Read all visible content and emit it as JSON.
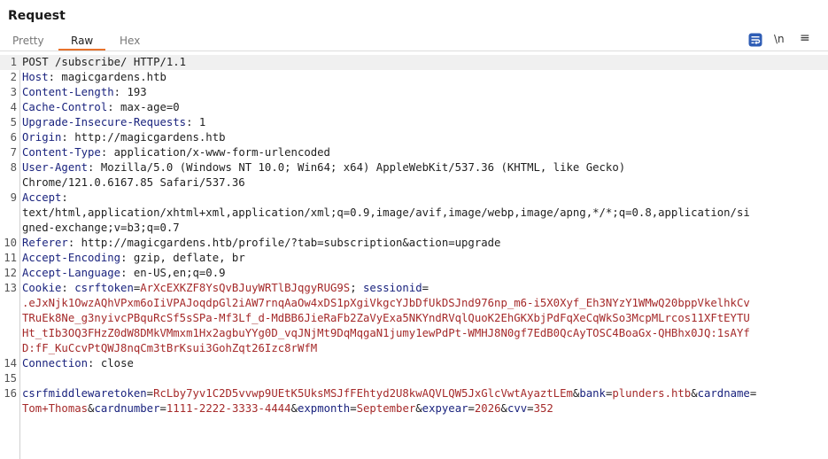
{
  "panel": {
    "title": "Request"
  },
  "tabs": [
    {
      "label": "Pretty"
    },
    {
      "label": "Raw"
    },
    {
      "label": "Hex"
    }
  ],
  "toolbar": {
    "newline_label": "\\n",
    "menu_label": "≡",
    "wrap_icon": "wrap-lines-icon"
  },
  "colors": {
    "accent": "#e8722c",
    "header_name": "#1a237e",
    "param_value": "#a52a2a",
    "highlight_btn": "#2f5db5"
  },
  "request": {
    "lines": [
      {
        "n": "1",
        "text": "POST /subscribe/ HTTP/1.1"
      },
      {
        "n": "2",
        "name": "Host",
        "value": ": magicgardens.htb"
      },
      {
        "n": "3",
        "name": "Content-Length",
        "value": ": 193"
      },
      {
        "n": "4",
        "name": "Cache-Control",
        "value": ": max-age=0"
      },
      {
        "n": "5",
        "name": "Upgrade-Insecure-Requests",
        "value": ": 1"
      },
      {
        "n": "6",
        "name": "Origin",
        "value": ": http://magicgardens.htb"
      },
      {
        "n": "7",
        "name": "Content-Type",
        "value": ": application/x-www-form-urlencoded"
      },
      {
        "n": "8",
        "name": "User-Agent",
        "value": ": Mozilla/5.0 (Windows NT 10.0; Win64; x64) AppleWebKit/537.36 (KHTML, like Gecko)"
      },
      {
        "n": "",
        "text": "Chrome/121.0.6167.85 Safari/537.36"
      },
      {
        "n": "9",
        "name": "Accept",
        "value": ":"
      },
      {
        "n": "",
        "text": "text/html,application/xhtml+xml,application/xml;q=0.9,image/avif,image/webp,image/apng,*/*;q=0.8,application/si"
      },
      {
        "n": "",
        "text": "gned-exchange;v=b3;q=0.7"
      },
      {
        "n": "10",
        "name": "Referer",
        "value": ": http://magicgardens.htb/profile/?tab=subscription&action=upgrade"
      },
      {
        "n": "11",
        "name": "Accept-Encoding",
        "value": ": gzip, deflate, br"
      },
      {
        "n": "12",
        "name": "Accept-Language",
        "value": ": en-US,en;q=0.9"
      }
    ],
    "cookie": {
      "n": "13",
      "name": "Cookie",
      "sep": ": ",
      "csrf_name": "csrftoken",
      "csrf_value": "ArXcEXKZF8YsQvBJuyWRTlBJqgyRUG9S",
      "semi": "; ",
      "session_name": "sessionid",
      "eq": "=",
      "session_lines": [
        ".eJxNjk1OwzAQhVPxm6oIiVPAJoqdpGl2iAW7rnqAaOw4xDS1pXgiVkgcYJbDfUkDSJnd976np_m6-i5X0Xyf_Eh3NYzY1WMwQ20bppVkelhkCv",
        "TRuEk8Ne_g3nyivcPBquRcSf5sSPa-Mf3Lf_d-MdBB6JieRaFb2ZaVyExa5NKYndRVqlQuoK2EhGKXbjPdFqXeCqWkSo3McpMLrcos11XFtEYTU",
        "Ht_tIb3OQ3FHzZ0dW8DMkVMmxm1Hx2agbuYYg0D_vqJNjMt9DqMqgaN1jumy1ewPdPt-WMHJ8N0gf7EdB0QcAyTOSC4BoaGx-QHBhx0JQ:1sAYf",
        "D:fF_KuCcvPtQWJ8nqCm3tBrKsui3GohZqt26Izc8rWfM"
      ]
    },
    "connection": {
      "n": "14",
      "name": "Connection",
      "value": ": close"
    },
    "blank": {
      "n": "15"
    },
    "body": {
      "n": "16",
      "line1": [
        {
          "name": "csrfmiddlewaretoken",
          "value": "RcLby7yv1C2D5vvwp9UEtK5UksMSJfFEhtyd2U8kwAQVLQW5JxGlcVwtAyaztLEm"
        },
        {
          "name": "bank",
          "value": "plunders.htb"
        },
        {
          "name": "cardname",
          "value": ""
        }
      ],
      "line2": [
        {
          "value": "Tom+Thomas"
        },
        {
          "name": "cardnumber",
          "value": "1111-2222-3333-4444"
        },
        {
          "name": "expmonth",
          "value": "September"
        },
        {
          "name": "expyear",
          "value": "2026"
        },
        {
          "name": "cvv",
          "value": "352"
        }
      ],
      "amp": "&",
      "eq": "="
    }
  }
}
